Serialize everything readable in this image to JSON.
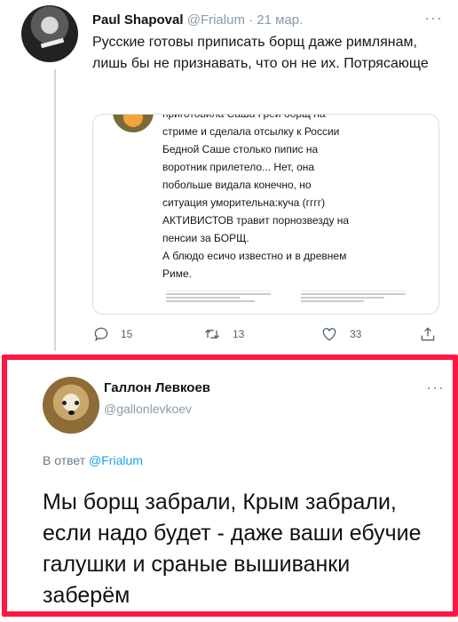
{
  "tweet": {
    "name": "Paul Shapoval",
    "handle": "@Frialum",
    "dot": "·",
    "date": "21 мар.",
    "more": "···",
    "text": "Русские готовы приписать борщ даже римлянам, лишь бы не признавать, что он не их. Потрясающе",
    "quote": {
      "cut_line": "приготовила Саша Грей борщ на",
      "lines": [
        "стриме и сделала отсылку к России",
        "Бедной Саше столько пипис на",
        "воротник прилетело... Нет, она",
        "побольше видала конечно, но",
        "ситуация уморительна:куча (гггг)",
        "АКТИВИСТОВ травит порнозвезду на",
        "пенсии за БОРЩ.",
        "А блюдо есичо известно и в древнем",
        "Риме."
      ]
    },
    "actions": {
      "replies": "15",
      "retweets": "13",
      "likes": "33"
    }
  },
  "reply": {
    "name": "Галлон Левкоев",
    "handle": "@gallonlevkoev",
    "more": "···",
    "replying_prefix": "В ответ",
    "replying_to": "@Frialum",
    "text": "Мы борщ забрали, Крым забрали, если надо будет - даже ваши ебучие галушки и сраные вышиванки заберём"
  },
  "colors": {
    "accent": "#1da1f2",
    "highlight_frame": "#ff1744",
    "muted": "#8a9aa8"
  }
}
